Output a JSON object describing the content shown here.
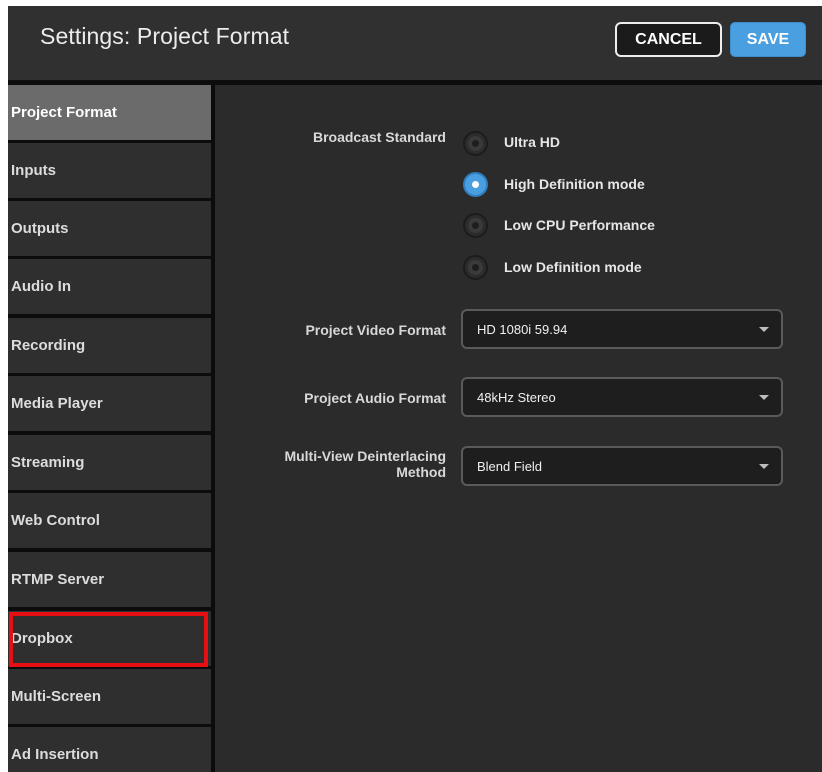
{
  "header": {
    "title": "Settings: Project Format",
    "cancel_label": "CANCEL",
    "save_label": "SAVE"
  },
  "sidebar": {
    "active": "Project Format",
    "highlighted": "Dropbox",
    "items": [
      {
        "label": "Project Format"
      },
      {
        "label": "Inputs"
      },
      {
        "label": "Outputs"
      },
      {
        "label": "Audio In"
      },
      {
        "label": "Recording"
      },
      {
        "label": "Media Player"
      },
      {
        "label": "Streaming"
      },
      {
        "label": "Web Control"
      },
      {
        "label": "RTMP Server"
      },
      {
        "label": "Dropbox"
      },
      {
        "label": "Multi-Screen"
      },
      {
        "label": "Ad Insertion"
      }
    ]
  },
  "form": {
    "broadcast_standard": {
      "label": "Broadcast Standard",
      "selected": "High Definition mode",
      "options": [
        {
          "label": "Ultra HD",
          "checked": false
        },
        {
          "label": "High Definition mode",
          "checked": true
        },
        {
          "label": "Low CPU Performance",
          "checked": false
        },
        {
          "label": "Low Definition mode",
          "checked": false
        }
      ]
    },
    "video_format": {
      "label": "Project Video Format",
      "value": "HD 1080i 59.94"
    },
    "audio_format": {
      "label": "Project Audio Format",
      "value": "48kHz Stereo"
    },
    "deinterlacing": {
      "label_line1": "Multi-View Deinterlacing",
      "label_line2": "Method",
      "value": "Blend Field"
    }
  },
  "colors": {
    "accent": "#4a9fe0",
    "highlight": "#e60f14",
    "background": "#2b2b2b"
  }
}
